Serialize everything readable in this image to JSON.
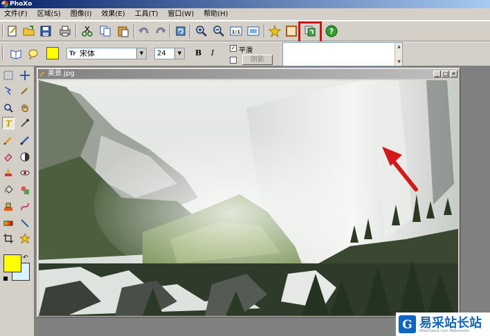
{
  "app": {
    "title": "PhoXo"
  },
  "menu": [
    "文件(F)",
    "区域(S)",
    "图像(I)",
    "效果(E)",
    "工具(T)",
    "窗口(W)",
    "帮助(H)"
  ],
  "toolbar": {
    "buttons": [
      "new-icon",
      "open-icon",
      "save-icon",
      "print-icon",
      "cut-icon",
      "copy-icon",
      "paste-icon",
      "undo-icon",
      "redo-icon",
      "rotate-icon",
      "zoom-in-icon",
      "zoom-out-icon",
      "actual-size-icon",
      "fit-window-icon",
      "star-icon",
      "frame-icon",
      "layer-icon",
      "help-icon"
    ],
    "highlighted": "layer-icon",
    "highlight_color": "#cc1111"
  },
  "text_options": {
    "text_color": "#ffff00",
    "font": "宋体",
    "size": "24",
    "bold_label": "B",
    "italic_label": "I",
    "smooth_label": "平滑",
    "smooth_checked": true,
    "shadow_label": "阴影",
    "shadow_checked": false
  },
  "document": {
    "title": "美景.jpg"
  },
  "colors": {
    "foreground": "#ffff00",
    "background": "#d8f4ff"
  },
  "watermark": {
    "title": "易采站长站",
    "url": "Www.Easck.Com Webmaster"
  }
}
